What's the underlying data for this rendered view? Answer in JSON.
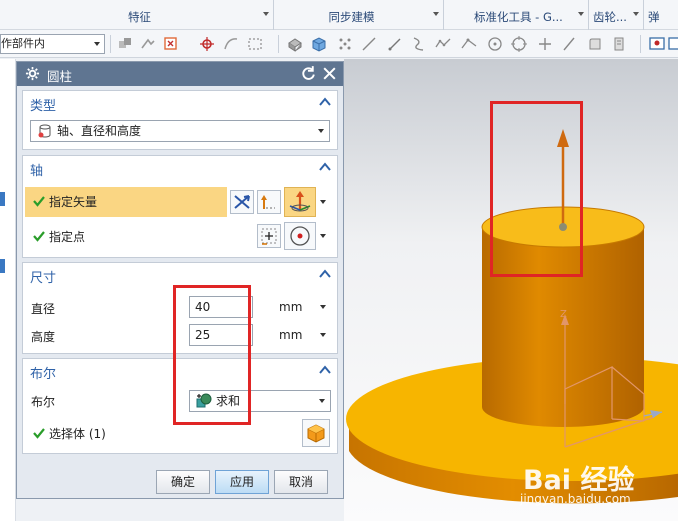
{
  "ribbon": {
    "groups": [
      {
        "label": "特征"
      },
      {
        "label": "同步建模"
      },
      {
        "label": "标准化工具 - G..."
      },
      {
        "label": "齿轮..."
      },
      {
        "label": "弹簧..."
      }
    ]
  },
  "toolbar": {
    "scope_combo": "工作部件内",
    "icons": [
      "assembly-icon",
      "snap-icon",
      "select-filter-icon",
      "point-snap-icon",
      "curve-snap-icon",
      "box-select-icon",
      "solid-icon",
      "cube-icon",
      "grid-point-icon",
      "line-icon",
      "diagonal-icon",
      "spline-icon",
      "polyline-icon",
      "circle-center-icon",
      "circle-icon",
      "plus-icon",
      "slash-icon",
      "quarter-icon",
      "bookmark-icon",
      "view-icon",
      "layout-icon"
    ]
  },
  "dialog": {
    "title": "圆柱",
    "sections": {
      "type": {
        "title": "类型",
        "selected": "轴、直径和高度"
      },
      "axis": {
        "title": "轴",
        "specify_vector": "指定矢量",
        "specify_point": "指定点"
      },
      "dimensions": {
        "title": "尺寸",
        "diameter_label": "直径",
        "diameter_value": "40",
        "diameter_unit": "mm",
        "height_label": "高度",
        "height_value": "25",
        "height_unit": "mm"
      },
      "boolean": {
        "title": "布尔",
        "label": "布尔",
        "selected": "求和",
        "select_body": "选择体 (1)"
      }
    },
    "buttons": {
      "ok": "确定",
      "apply": "应用",
      "cancel": "取消"
    }
  },
  "viewport": {
    "axis_label": "Z",
    "watermark": "Bai 经验",
    "watermark_url": "jingyan.baidu.com"
  },
  "colors": {
    "title_bar": "#5f7591",
    "section_title": "#2f62a8",
    "highlight": "#fad683",
    "model_top": "#f7b500",
    "model_side": "#d98300",
    "annotation": "#e02525",
    "check": "#2a9d2a"
  }
}
